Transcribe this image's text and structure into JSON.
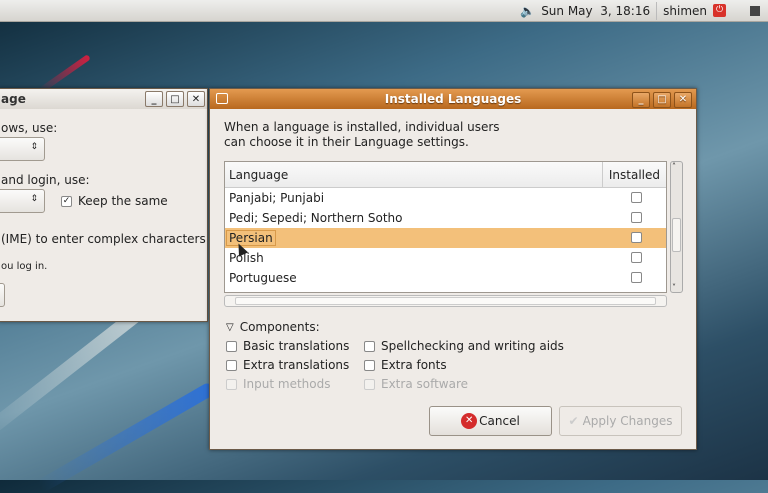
{
  "panel": {
    "datetime": "Sun May  3, 18:16",
    "user": "shimen"
  },
  "left_window": {
    "title": "age",
    "line1": "ows, use:",
    "line2": "and login, use:",
    "keep_same": "Keep the same",
    "keep_same_checked": true,
    "ime_text": "(IME) to enter complex characters",
    "login_text": "ou log in."
  },
  "dialog": {
    "title": "Installed Languages",
    "intro": [
      "When a language is installed, individual users",
      "can choose it in their Language settings."
    ],
    "columns": {
      "language": "Language",
      "installed": "Installed"
    },
    "rows": [
      {
        "name": "Panjabi; Punjabi",
        "installed": false,
        "selected": false
      },
      {
        "name": "Pedi; Sepedi; Northern Sotho",
        "installed": false,
        "selected": false
      },
      {
        "name": "Persian",
        "installed": false,
        "selected": true
      },
      {
        "name": "Polish",
        "installed": false,
        "selected": false
      },
      {
        "name": "Portuguese",
        "installed": false,
        "selected": false
      }
    ],
    "components_label": "Components:",
    "components": [
      {
        "label": "Basic translations",
        "enabled": true
      },
      {
        "label": "Spellchecking and writing aids",
        "enabled": true
      },
      {
        "label": "Extra translations",
        "enabled": true
      },
      {
        "label": "Extra fonts",
        "enabled": true
      },
      {
        "label": "Input methods",
        "enabled": false
      },
      {
        "label": "Extra software",
        "enabled": false
      }
    ],
    "cancel": "Cancel",
    "apply": "Apply Changes"
  },
  "colors": {
    "titlebar": "#c87a30",
    "selection": "#f3c07a"
  }
}
